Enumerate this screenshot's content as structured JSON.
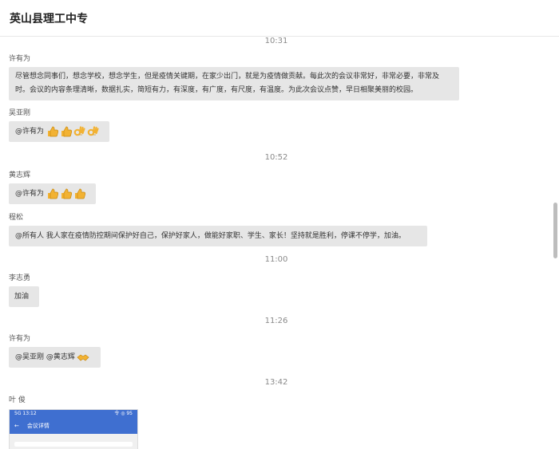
{
  "app": {
    "title": "英山县理工中专"
  },
  "chat": {
    "items": [
      {
        "type": "time",
        "text": "10:31"
      },
      {
        "type": "name",
        "text": "许有为"
      },
      {
        "type": "bubble",
        "text": "尽管想念同事们，想念学校，想念学生，但是疫情关键期，在家少出门，就是为疫情做贡献。每此次的会议非常好，非常必要，非常及时。会议的内容条理清晰，数据扎实，简短有力，有深度，有广度，有尺度，有温度。为此次会议点赞，早日相聚美丽的校园。"
      },
      {
        "type": "name",
        "text": "吴亚刚"
      },
      {
        "type": "bubble",
        "text": "@许有为",
        "emojis": [
          "thumbs-up",
          "thumbs-up",
          "ok-hand",
          "ok-hand"
        ]
      },
      {
        "type": "time",
        "text": "10:52"
      },
      {
        "type": "name",
        "text": "黄志辉"
      },
      {
        "type": "bubble",
        "text": "@许有为",
        "emojis": [
          "thumbs-up",
          "thumbs-up",
          "thumbs-up"
        ]
      },
      {
        "type": "name",
        "text": "程松"
      },
      {
        "type": "bubble",
        "text": "@所有人  我人家在疫情防控期间保护好自己，保护好家人，做能好家职、学生、家长！坚持就是胜利，停课不停学，加油。"
      },
      {
        "type": "time",
        "text": "11:00"
      },
      {
        "type": "name",
        "text": "李志勇"
      },
      {
        "type": "bubble",
        "text": "加油"
      },
      {
        "type": "time",
        "text": "11:26"
      },
      {
        "type": "name",
        "text": "许有为"
      },
      {
        "type": "bubble",
        "text": "@吴亚刚 @黄志辉",
        "emojis": [
          "handshake"
        ]
      },
      {
        "type": "time",
        "text": "13:42"
      },
      {
        "type": "name",
        "text": "叶 俊"
      }
    ]
  },
  "thumbnail": {
    "status_left": "5G 13:12",
    "status_right": "令 ◎ 95",
    "back_icon": "arrow-left-icon",
    "title": "会议详情"
  },
  "icons": {
    "thumbs-up": "thumbs-up-icon",
    "ok-hand": "ok-hand-icon",
    "handshake": "handshake-icon"
  },
  "colors": {
    "bubble": "#e6e6e6",
    "emoji": "#f2b233",
    "accent": "#3f6fd0"
  }
}
